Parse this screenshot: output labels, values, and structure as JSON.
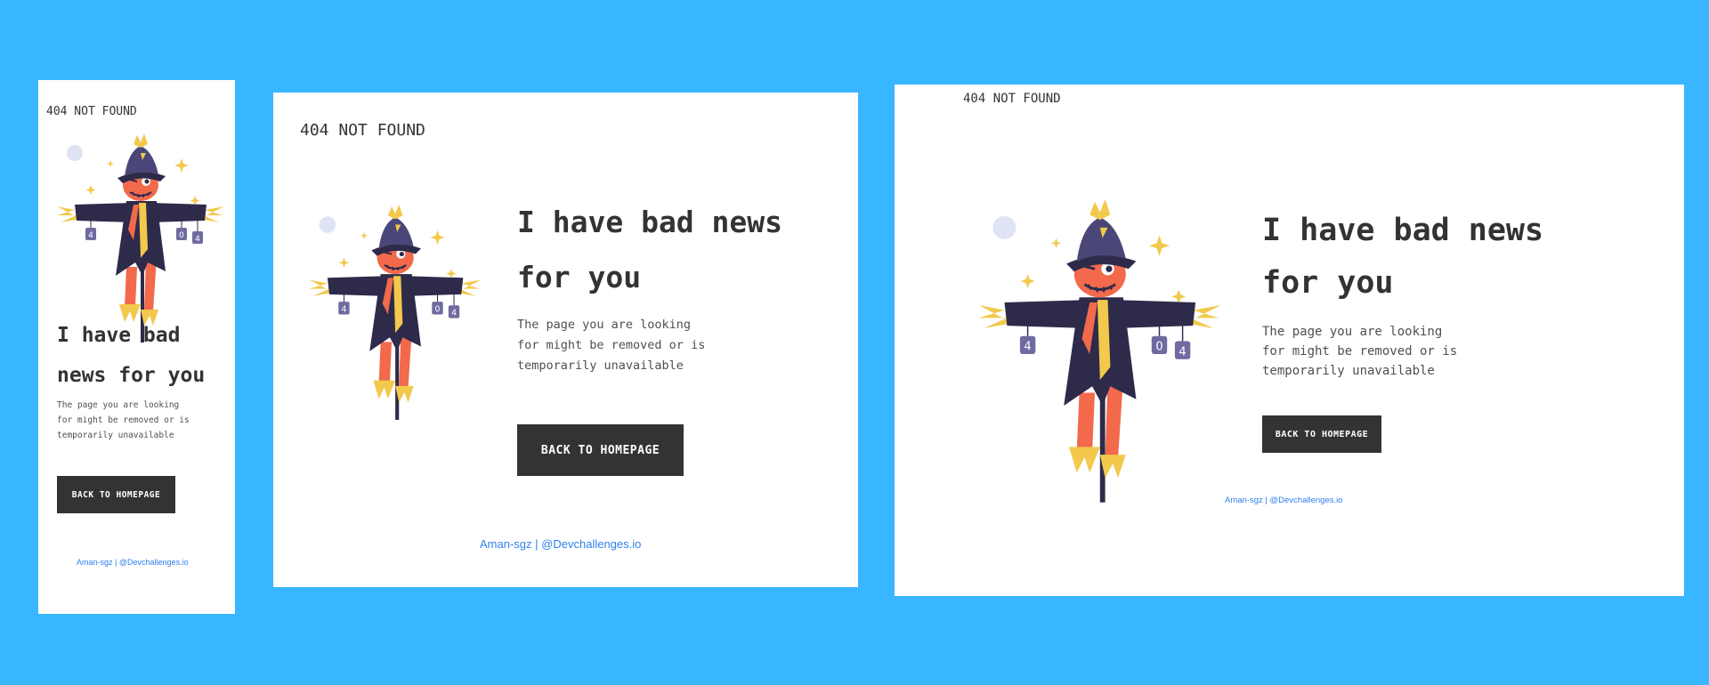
{
  "brand": "404 NOT FOUND",
  "headline_mobile": "I have bad news for you",
  "headline_line1": "I have bad news",
  "headline_line2": "for you",
  "headline_m_line1": "I have bad",
  "headline_m_line2": "news for you",
  "description_lines": [
    "The page you are looking",
    "for might be removed or is",
    "temporarily unavailable"
  ],
  "cta_label": "BACK TO HOMEPAGE",
  "footer": {
    "author": "Aman-sgz",
    "separator": "|",
    "site": "@Devchallenges.io"
  },
  "sign_letters": [
    "4",
    "0",
    "4"
  ],
  "colors": {
    "background": "#38b6ff",
    "card": "#ffffff",
    "button": "#333333",
    "link": "#2f80ed"
  }
}
